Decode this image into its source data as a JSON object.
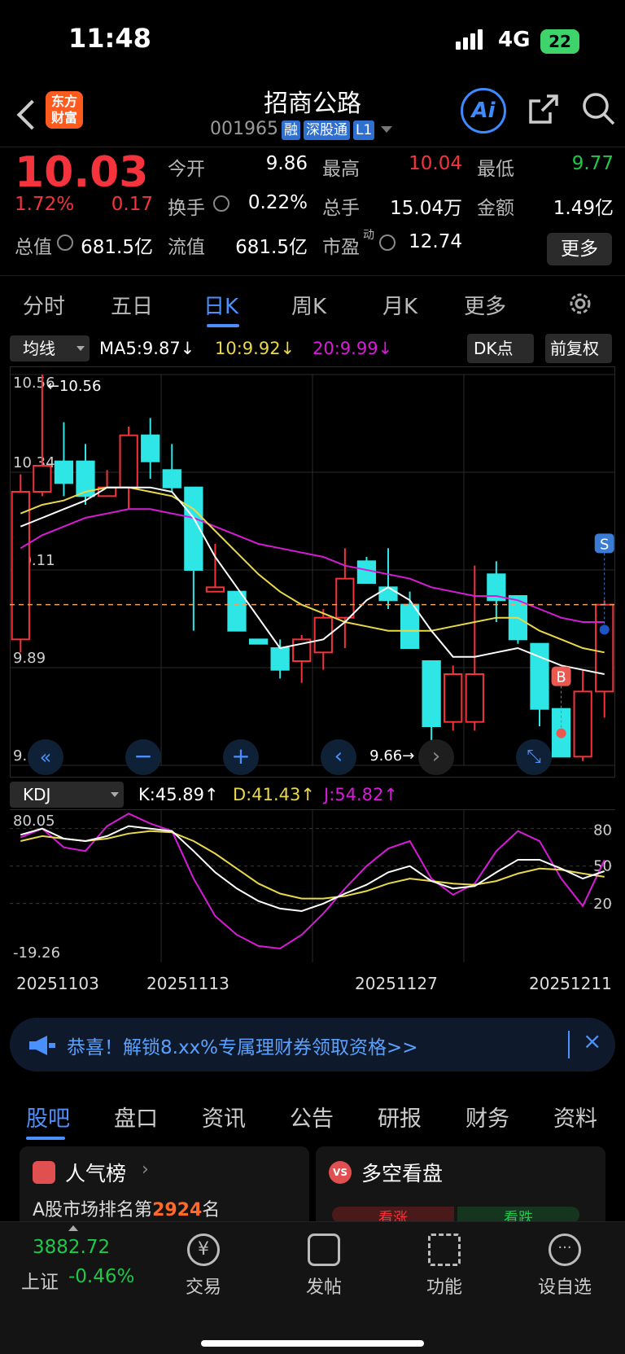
{
  "status": {
    "time": "11:48",
    "network": "4G",
    "battery": "22"
  },
  "header": {
    "logo_line1": "东方",
    "logo_line2": "财富",
    "title": "招商公路",
    "code": "001965",
    "tags": [
      "融",
      "深股通",
      "L1"
    ],
    "ai_label": "Ai"
  },
  "quote": {
    "price": "10.03",
    "pct": "1.72%",
    "change": "0.17",
    "rows": [
      [
        {
          "label": "今开",
          "value": "9.86",
          "color": "#ffffff"
        },
        {
          "label": "最高",
          "value": "10.04",
          "color": "#f4333c"
        },
        {
          "label": "最低",
          "value": "9.77",
          "color": "#1ec84a"
        }
      ],
      [
        {
          "label": "换手",
          "value": "0.22%",
          "color": "#ffffff"
        },
        {
          "label": "总手",
          "value": "15.04万",
          "color": "#ffffff"
        },
        {
          "label": "金额",
          "value": "1.49亿",
          "color": "#ffffff"
        }
      ],
      [
        {
          "label": "总值",
          "value": "681.5亿",
          "color": "#ffffff"
        },
        {
          "label": "流值",
          "value": "681.5亿",
          "color": "#ffffff"
        },
        {
          "label": "市盈",
          "value": "12.74",
          "color": "#ffffff"
        }
      ]
    ],
    "pe_sup": "动",
    "more": "更多"
  },
  "period_tabs": [
    "分时",
    "五日",
    "日K",
    "周K",
    "月K",
    "更多"
  ],
  "indicators": {
    "ma_select": "均线",
    "ma5": "MA5:9.87↓",
    "ma10": "10:9.92↓",
    "ma20": "20:9.99↓",
    "dk": "DK点",
    "adjust": "前复权"
  },
  "kdj": {
    "select": "KDJ",
    "k": "K:45.89↑",
    "d": "D:41.43↑",
    "j": "J:54.82↑"
  },
  "chart_data": [
    {
      "type": "candlestick",
      "ylim": [
        9.66,
        10.56
      ],
      "y_ticks": [
        "10.56",
        "10.34",
        "10.11",
        "9.89",
        "9.66"
      ],
      "annotations": {
        "high": "←10.56",
        "low": "9.66→",
        "buy": "B",
        "sell": "S"
      },
      "candles": [
        {
          "o": 9.95,
          "c": 10.29,
          "h": 10.33,
          "l": 9.92
        },
        {
          "o": 10.29,
          "c": 10.35,
          "h": 10.56,
          "l": 10.28
        },
        {
          "o": 10.36,
          "c": 10.31,
          "h": 10.45,
          "l": 10.28
        },
        {
          "o": 10.36,
          "c": 10.28,
          "h": 10.4,
          "l": 10.26
        },
        {
          "o": 10.28,
          "c": 10.3,
          "h": 10.34,
          "l": 10.28
        },
        {
          "o": 10.3,
          "c": 10.42,
          "h": 10.44,
          "l": 10.25
        },
        {
          "o": 10.42,
          "c": 10.36,
          "h": 10.46,
          "l": 10.32
        },
        {
          "o": 10.34,
          "c": 10.3,
          "h": 10.4,
          "l": 10.29
        },
        {
          "o": 10.3,
          "c": 10.11,
          "h": 10.3,
          "l": 9.97
        },
        {
          "o": 10.06,
          "c": 10.07,
          "h": 10.17,
          "l": 10.07
        },
        {
          "o": 10.06,
          "c": 9.97,
          "h": 10.06,
          "l": 9.97
        },
        {
          "o": 9.95,
          "c": 9.94,
          "h": 9.95,
          "l": 9.94
        },
        {
          "o": 9.93,
          "c": 9.88,
          "h": 9.95,
          "l": 9.86
        },
        {
          "o": 9.9,
          "c": 9.95,
          "h": 9.96,
          "l": 9.85
        },
        {
          "o": 9.92,
          "c": 10.0,
          "h": 10.02,
          "l": 9.88
        },
        {
          "o": 10.0,
          "c": 10.09,
          "h": 10.16,
          "l": 9.93
        },
        {
          "o": 10.13,
          "c": 10.08,
          "h": 10.14,
          "l": 10.09
        },
        {
          "o": 10.07,
          "c": 10.04,
          "h": 10.16,
          "l": 10.02
        },
        {
          "o": 10.03,
          "c": 9.93,
          "h": 10.06,
          "l": 9.93
        },
        {
          "o": 9.9,
          "c": 9.75,
          "h": 9.9,
          "l": 9.66
        },
        {
          "o": 9.76,
          "c": 9.87,
          "h": 9.89,
          "l": 9.74
        },
        {
          "o": 9.76,
          "c": 9.87,
          "h": 10.12,
          "l": 9.74
        },
        {
          "o": 10.1,
          "c": 10.04,
          "h": 10.13,
          "l": 9.99
        },
        {
          "o": 10.05,
          "c": 9.95,
          "h": 10.05,
          "l": 9.94
        },
        {
          "o": 9.94,
          "c": 9.79,
          "h": 9.94,
          "l": 9.75
        },
        {
          "o": 9.79,
          "c": 9.68,
          "h": 9.79,
          "l": 9.68
        },
        {
          "o": 9.68,
          "c": 9.83,
          "h": 9.88,
          "l": 9.67
        },
        {
          "o": 9.83,
          "c": 10.03,
          "h": 10.04,
          "l": 9.77
        }
      ],
      "ma5": [
        10.21,
        10.23,
        10.25,
        10.27,
        10.3,
        10.3,
        10.3,
        10.29,
        10.23,
        10.14,
        10.07,
        10.0,
        9.93,
        9.94,
        9.95,
        9.99,
        10.04,
        10.07,
        10.04,
        9.97,
        9.91,
        9.91,
        9.92,
        9.93,
        9.91,
        9.89,
        9.88,
        9.87
      ],
      "ma10": [
        10.24,
        10.26,
        10.27,
        10.29,
        10.3,
        10.3,
        10.29,
        10.28,
        10.25,
        10.2,
        10.15,
        10.1,
        10.06,
        10.03,
        10.01,
        9.99,
        9.98,
        9.97,
        9.97,
        9.97,
        9.98,
        9.99,
        10.0,
        10.0,
        9.97,
        9.95,
        9.93,
        9.92
      ],
      "ma20": [
        10.16,
        10.19,
        10.21,
        10.23,
        10.24,
        10.25,
        10.25,
        10.24,
        10.23,
        10.21,
        10.19,
        10.17,
        10.16,
        10.15,
        10.14,
        10.12,
        10.11,
        10.1,
        10.09,
        10.07,
        10.06,
        10.05,
        10.05,
        10.04,
        10.02,
        10.0,
        9.99,
        9.99
      ],
      "current_price": 10.03
    },
    {
      "type": "line",
      "title": "KDJ",
      "ylim": [
        -19.26,
        85
      ],
      "y_ticks_left": [
        "80.05",
        "-19.26"
      ],
      "y_ticks_right": [
        "80",
        "50",
        "20"
      ],
      "series": [
        {
          "name": "K",
          "color": "#ffffff",
          "values": [
            75,
            80,
            72,
            70,
            74,
            82,
            80,
            78,
            62,
            45,
            32,
            22,
            16,
            14,
            20,
            28,
            35,
            45,
            50,
            38,
            32,
            34,
            45,
            55,
            55,
            48,
            40,
            45.89
          ]
        },
        {
          "name": "D",
          "color": "#e8d84a",
          "values": [
            70,
            74,
            72,
            70,
            72,
            76,
            78,
            77,
            70,
            60,
            48,
            36,
            28,
            24,
            24,
            26,
            30,
            36,
            40,
            38,
            36,
            35,
            38,
            44,
            48,
            47,
            44,
            41.43
          ]
        },
        {
          "name": "J",
          "color": "#d81bd8",
          "values": [
            73,
            80,
            65,
            62,
            82,
            92,
            84,
            78,
            40,
            10,
            -5,
            -14,
            -16,
            -5,
            12,
            32,
            50,
            64,
            70,
            40,
            27,
            36,
            62,
            78,
            70,
            40,
            18,
            54.82
          ]
        }
      ]
    }
  ],
  "dates": [
    "20251103",
    "20251113",
    "20251127",
    "20251211"
  ],
  "banner": {
    "text": "恭喜！解锁8.xx%专属理财券领取资格>>"
  },
  "bottom_tabs": [
    "股吧",
    "盘口",
    "资讯",
    "公告",
    "研报",
    "财务",
    "资料"
  ],
  "cards": {
    "left_title": "人气榜",
    "left_sub_prefix": "A股市场排名第",
    "left_rank": "2924",
    "left_sub_suffix": "名",
    "right_title": "多空看盘",
    "right_up": "看涨",
    "right_down": "看跌"
  },
  "footer": {
    "index_value": "3882.72",
    "index_name": "上证",
    "index_change": "-0.46%",
    "items": [
      "交易",
      "发帖",
      "功能",
      "设自选"
    ]
  }
}
